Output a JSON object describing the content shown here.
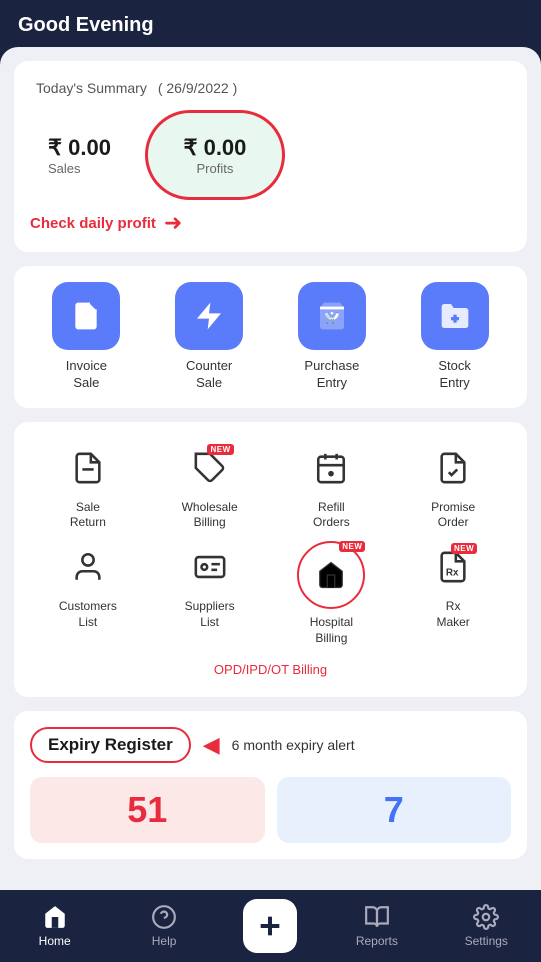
{
  "header": {
    "greeting": "Good Evening"
  },
  "summary": {
    "title": "Today's Summary",
    "date": "( 26/9/2022 )",
    "sales_amount": "₹ 0.00",
    "sales_label": "Sales",
    "profit_amount": "₹ 0.00",
    "profit_label": "Profits",
    "check_profit_text": "Check daily profit"
  },
  "quick_actions": [
    {
      "id": "invoice-sale",
      "label": "Invoice\nSale",
      "icon": "file"
    },
    {
      "id": "counter-sale",
      "label": "Counter\nSale",
      "icon": "bolt"
    },
    {
      "id": "purchase-entry",
      "label": "Purchase\nEntry",
      "icon": "cart"
    },
    {
      "id": "stock-entry",
      "label": "Stock\nEntry",
      "icon": "folder-plus"
    }
  ],
  "secondary_actions": [
    {
      "id": "sale-return",
      "label": "Sale\nReturn",
      "icon": "file-return",
      "new": false
    },
    {
      "id": "wholesale-billing",
      "label": "Wholesale\nBilling",
      "icon": "tag",
      "new": true
    },
    {
      "id": "refill-orders",
      "label": "Refill\nOrders",
      "icon": "calendar",
      "new": false
    },
    {
      "id": "promise-order",
      "label": "Promise\nOrder",
      "icon": "file-check",
      "new": false
    },
    {
      "id": "customers-list",
      "label": "Customers\nList",
      "icon": "user",
      "new": false
    },
    {
      "id": "suppliers-list",
      "label": "Suppliers\nList",
      "icon": "id-card",
      "new": false
    },
    {
      "id": "hospital-billing",
      "label": "Hospital\nBilling",
      "icon": "hospital",
      "new": true,
      "circled": true
    },
    {
      "id": "rx-maker",
      "label": "Rx\nMaker",
      "icon": "rx",
      "new": true
    }
  ],
  "opd_text": "OPD/IPD/OT Billing",
  "expiry": {
    "title": "Expiry Register",
    "alert_text": "6 month expiry alert",
    "red_number": "51",
    "blue_number": "7"
  },
  "bottom_nav": [
    {
      "id": "home",
      "label": "Home",
      "icon": "home",
      "active": true
    },
    {
      "id": "help",
      "label": "Help",
      "icon": "help"
    },
    {
      "id": "add",
      "label": "",
      "icon": "plus",
      "special": true
    },
    {
      "id": "reports",
      "label": "Reports",
      "icon": "book"
    },
    {
      "id": "settings",
      "label": "Settings",
      "icon": "gear"
    }
  ]
}
